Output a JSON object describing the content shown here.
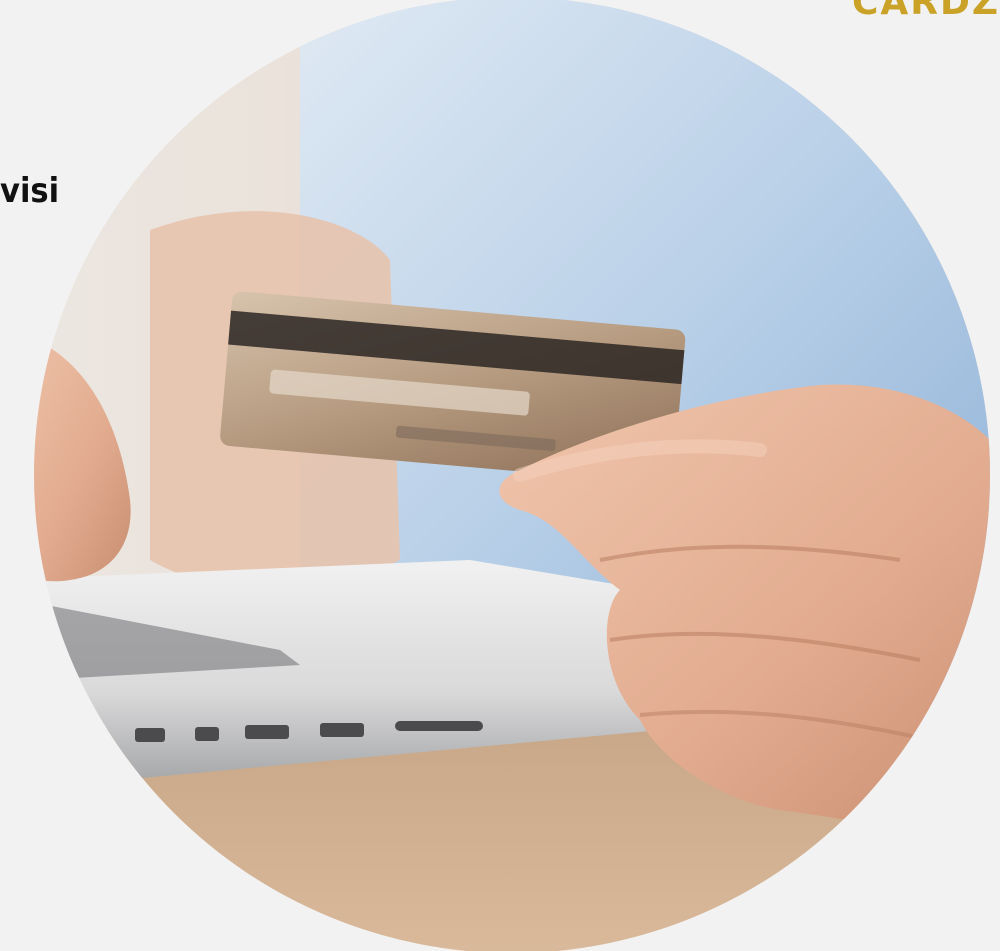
{
  "brand": {
    "text": "CARDZ",
    "color": "#c9a227"
  },
  "heading": {
    "text": "visi"
  },
  "hero_image": {
    "shape": "circle",
    "subject": "photo"
  },
  "colors": {
    "background": "#f2f2f2",
    "heading": "#111111"
  }
}
